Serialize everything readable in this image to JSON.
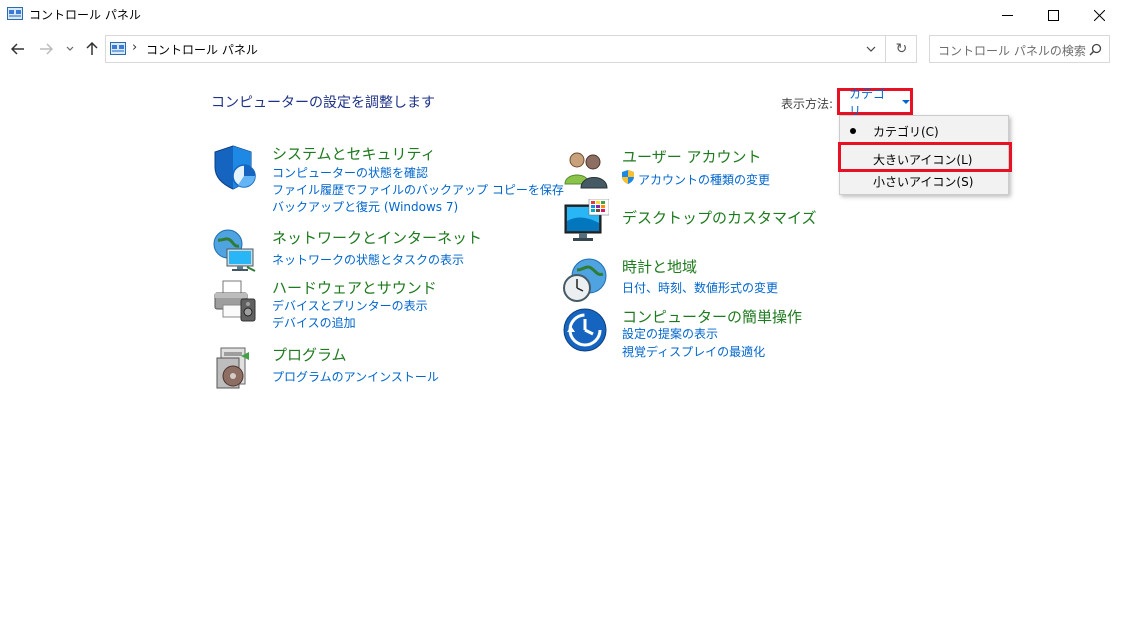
{
  "window": {
    "title": "コントロール パネル"
  },
  "nav": {
    "breadcrumb_separator": "›",
    "breadcrumb": "コントロール パネル",
    "refresh_glyph": "↻",
    "search_placeholder": "コントロール パネルの検索"
  },
  "main": {
    "heading": "コンピューターの設定を調整します",
    "view_by_label": "表示方法:",
    "view_by_value": "カテゴリ",
    "view_menu": {
      "items": [
        {
          "label": "カテゴリ(C)",
          "selected": true
        },
        {
          "label": "大きいアイコン(L)",
          "selected": false
        },
        {
          "label": "小さいアイコン(S)",
          "selected": false
        }
      ]
    },
    "categories": [
      {
        "title": "システムとセキュリティ",
        "links": [
          "コンピューターの状態を確認",
          "ファイル履歴でファイルのバックアップ コピーを保存",
          "バックアップと復元 (Windows 7)"
        ]
      },
      {
        "title": "ネットワークとインターネット",
        "links": [
          "ネットワークの状態とタスクの表示"
        ]
      },
      {
        "title": "ハードウェアとサウンド",
        "links": [
          "デバイスとプリンターの表示",
          "デバイスの追加"
        ]
      },
      {
        "title": "プログラム",
        "links": [
          "プログラムのアンインストール"
        ]
      },
      {
        "title": "ユーザー アカウント",
        "links": [
          "アカウントの種類の変更"
        ]
      },
      {
        "title": "デスクトップのカスタマイズ",
        "links": []
      },
      {
        "title": "時計と地域",
        "links": [
          "日付、時刻、数値形式の変更"
        ]
      },
      {
        "title": "コンピューターの簡単操作",
        "links": [
          "設定の提案の表示",
          "視覚ディスプレイの最適化"
        ]
      }
    ]
  },
  "colors": {
    "heading": "#1e3287",
    "category_title": "#1e7a1e",
    "link": "#0066cc",
    "highlight": "#e81123"
  }
}
